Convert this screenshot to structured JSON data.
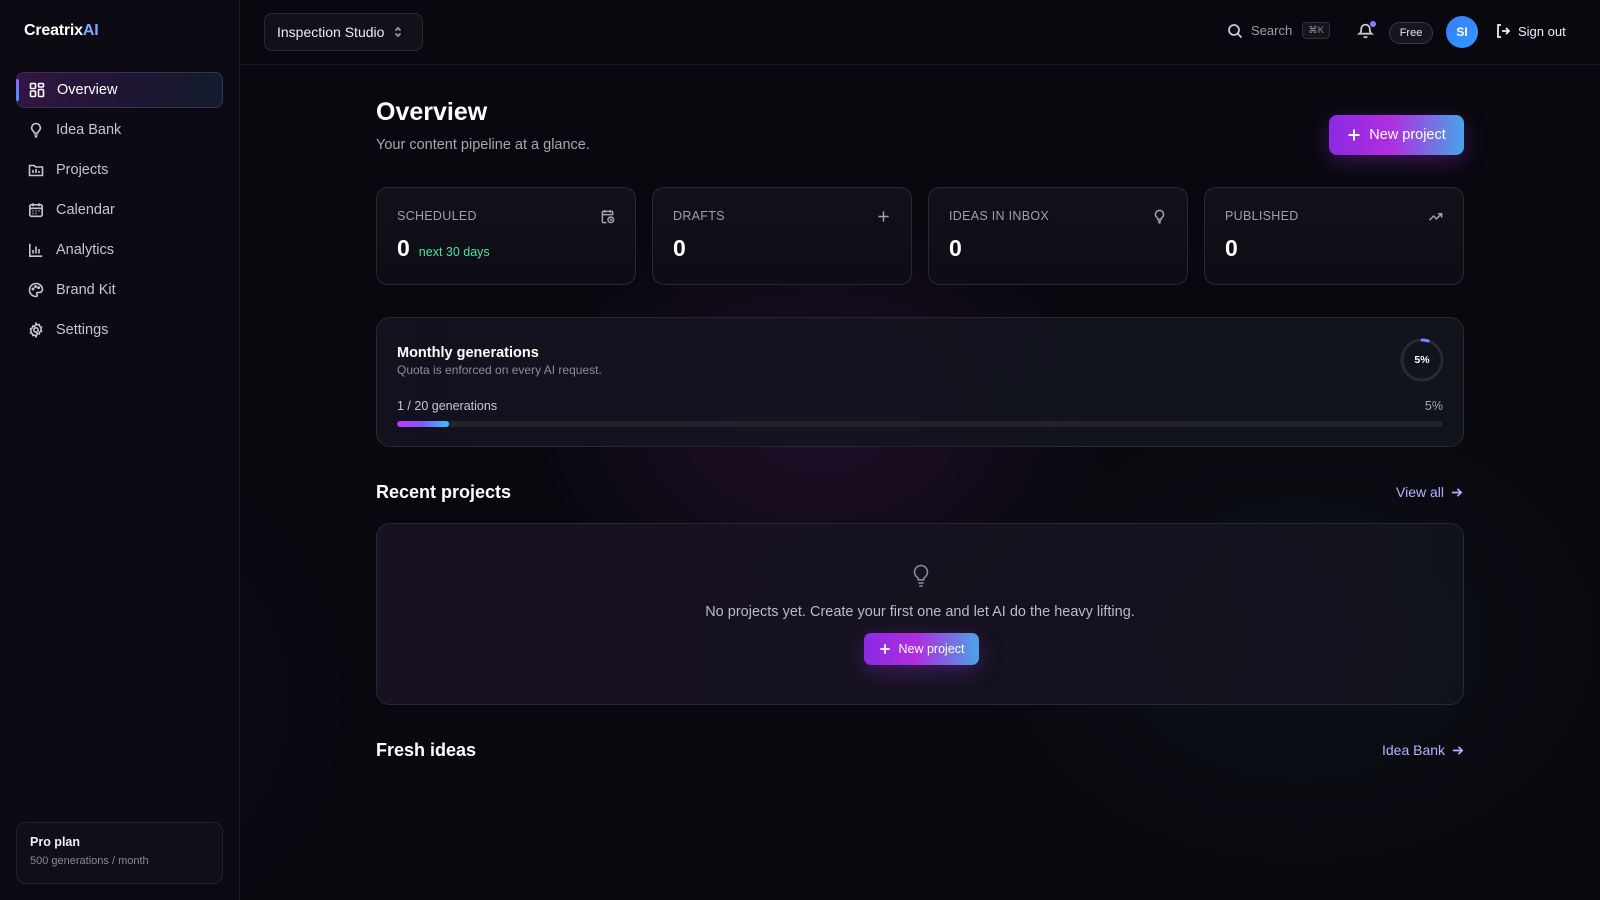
{
  "brand": {
    "name": "Creatrix",
    "suffix": "AI"
  },
  "sidebar": {
    "items": [
      {
        "label": "Overview",
        "icon": "grid-icon",
        "active": true
      },
      {
        "label": "Idea Bank",
        "icon": "lightbulb-icon"
      },
      {
        "label": "Projects",
        "icon": "folder-icon"
      },
      {
        "label": "Calendar",
        "icon": "calendar-icon"
      },
      {
        "label": "Analytics",
        "icon": "bar-chart-icon"
      },
      {
        "label": "Brand Kit",
        "icon": "palette-icon"
      },
      {
        "label": "Settings",
        "icon": "gear-icon"
      }
    ],
    "plan": {
      "title": "Pro plan",
      "subtitle": "500 generations / month"
    }
  },
  "topbar": {
    "workspace": "Inspection Studio",
    "search_label": "Search",
    "search_shortcut": "⌘K",
    "plan_badge": "Free",
    "avatar_initials": "SI",
    "signout_label": "Sign out"
  },
  "main": {
    "title": "Overview",
    "subtitle": "Your content pipeline at a glance.",
    "new_project_label": "New project",
    "stats": [
      {
        "label": "SCHEDULED",
        "value": "0",
        "note": "next 30 days",
        "icon": "calendar-clock-icon"
      },
      {
        "label": "DRAFTS",
        "value": "0",
        "note": "",
        "icon": "plus-icon"
      },
      {
        "label": "IDEAS IN INBOX",
        "value": "0",
        "note": "",
        "icon": "lightbulb-icon"
      },
      {
        "label": "PUBLISHED",
        "value": "0",
        "note": "",
        "icon": "trending-up-icon"
      }
    ],
    "quota": {
      "title": "Monthly generations",
      "subtitle": "Quota is enforced on every AI request.",
      "count_text": "1 / 20 generations",
      "percent_text": "5%",
      "percent": 5
    },
    "recent": {
      "title": "Recent projects",
      "link": "View all",
      "empty_text": "No projects yet. Create your first one and let AI do the heavy lifting.",
      "empty_button": "New project"
    },
    "fresh": {
      "title": "Fresh ideas",
      "link": "Idea Bank"
    }
  },
  "colors": {
    "accent": "#8a2be2",
    "accent_end": "#4aa3e8",
    "success": "#4be3a0",
    "background": "#09080e"
  }
}
